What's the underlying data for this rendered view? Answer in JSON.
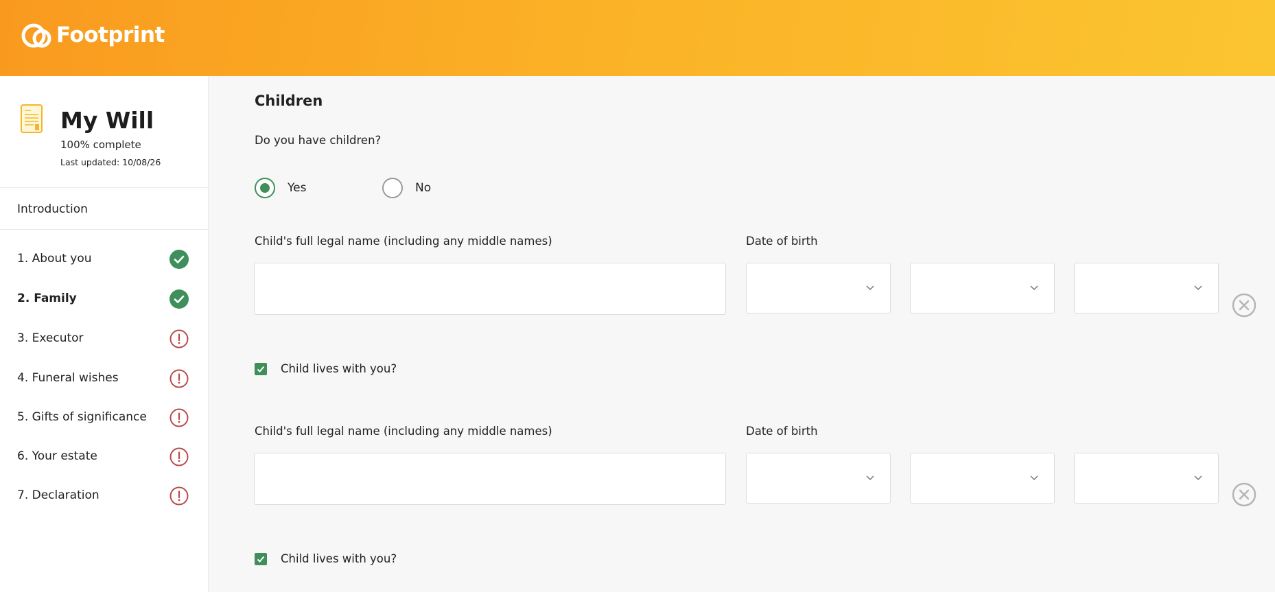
{
  "header": {
    "logo_text": "Footprint"
  },
  "sidebar": {
    "will_title": "My Will",
    "will_complete": "100% complete",
    "will_updated": "Last updated: 10/08/26",
    "intro_label": "Introduction",
    "items": [
      {
        "label": "1. About you",
        "status": "complete"
      },
      {
        "label": "2. Family",
        "status": "complete"
      },
      {
        "label": "3. Executor",
        "status": "incomplete"
      },
      {
        "label": "4. Funeral wishes",
        "status": "incomplete"
      },
      {
        "label": "5. Gifts of significance",
        "status": "incomplete"
      },
      {
        "label": "6. Your estate",
        "status": "incomplete"
      },
      {
        "label": "7. Declaration",
        "status": "incomplete"
      }
    ]
  },
  "main": {
    "section_title": "Children",
    "question": "Do you have children?",
    "options": [
      {
        "label": "Yes",
        "selected": true
      },
      {
        "label": "No",
        "selected": false
      }
    ],
    "children": [
      {
        "name_label": "Child's full legal name (including any middle names)",
        "name_value": "",
        "dob_label": "Date of birth",
        "dob_day": "",
        "dob_month": "",
        "dob_year": "",
        "lives_with_label": "Child lives with you?",
        "lives_with": true
      },
      {
        "name_label": "Child's full legal name (including any middle names)",
        "name_value": "",
        "dob_label": "Date of birth",
        "dob_day": "",
        "dob_month": "",
        "dob_year": "",
        "lives_with_label": "Child lives with you?",
        "lives_with": true
      }
    ]
  },
  "colors": {
    "accent_green": "#3f8f5a",
    "warning_red": "#b94a4a",
    "header_start": "#f99a1f",
    "header_end": "#fbc531"
  },
  "icons": {
    "logo": "footprint-logo-icon",
    "will": "document-icon",
    "complete": "check-circle-icon",
    "incomplete": "exclamation-circle-icon",
    "select": "chevron-down-icon",
    "remove": "close-circle-icon"
  }
}
